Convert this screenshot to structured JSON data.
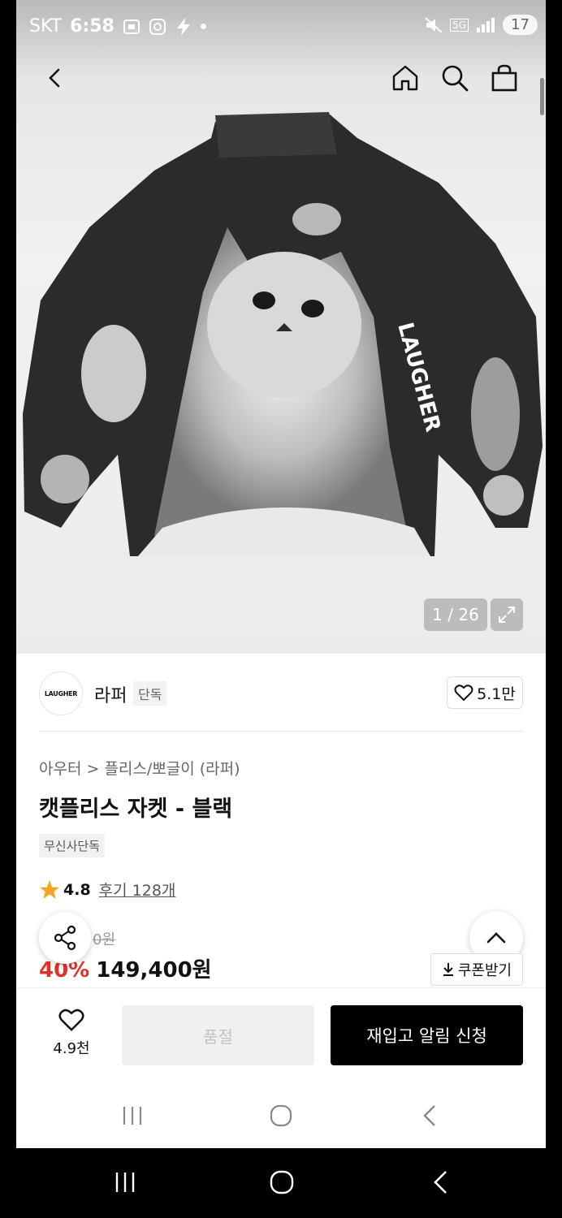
{
  "status_bar": {
    "carrier": "SKT",
    "time": "6:58",
    "network": "5G",
    "battery": "17"
  },
  "gallery": {
    "counter": "1 / 26",
    "jacket_print_text": "LAUGHER"
  },
  "brand": {
    "logo_text": "LAUGHER",
    "name": "라퍼",
    "tag": "단독",
    "likes": "5.1만"
  },
  "product": {
    "breadcrumb": "아우터 > 플리스/뽀글이 (라퍼)",
    "title": "캣플리스 자켓 - 블랙",
    "exclusive_tag": "무신사단독",
    "rating": "4.8",
    "reviews": "후기 128개",
    "original_price": "0원",
    "discount": "40%",
    "price": "149,400원",
    "coupon": "쿠폰받기"
  },
  "action_bar": {
    "wish_count": "4.9천",
    "soldout_label": "품절",
    "restock_label": "재입고 알림 신청"
  },
  "colors": {
    "discount": "#e0322b",
    "primary_button": "#000000"
  }
}
